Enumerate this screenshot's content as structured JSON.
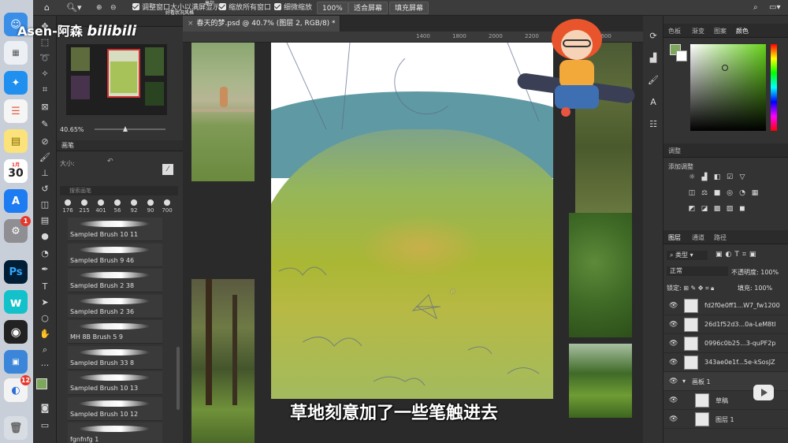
{
  "watermark": {
    "user": "Asen-阿森",
    "site": "bilibili"
  },
  "options_bar": {
    "resize_windows_label": "调整窗口大小以满屏显示",
    "zoom_all_label": "缩放所有窗口",
    "scrubby_zoom_label": "细微缩放",
    "zoom_percent": "100%",
    "fit_screen_label": "适合屏幕",
    "fill_screen_label": "填充屏幕",
    "tooltip_top": "高尔",
    "tooltip_bottom": "好看状况风格"
  },
  "document": {
    "tab_title": "春天的梦.psd @ 40.7% (图层 2, RGB/8) *",
    "ruler_marks": [
      "1400",
      "1800",
      "2000",
      "2200",
      "2400",
      "2600"
    ]
  },
  "navigator": {
    "zoom": "40.65%"
  },
  "brushes_panel": {
    "title": "画笔",
    "size_label": "大小:",
    "search_placeholder": "搜索画笔",
    "preset_sizes": [
      "176",
      "215",
      "401",
      "56",
      "92",
      "90",
      "700"
    ],
    "items": [
      {
        "label": "Sampled Brush 10 11"
      },
      {
        "label": "Sampled Brush 9 46"
      },
      {
        "label": "Sampled Brush 2 38"
      },
      {
        "label": "Sampled Brush 2 36"
      },
      {
        "label": "MH 8B Brush 5 9"
      },
      {
        "label": "Sampled Brush 33 8"
      },
      {
        "label": "Sampled Brush 10 13"
      },
      {
        "label": "Sampled Brush 10 12"
      },
      {
        "label": "fgnfnfg 1"
      }
    ]
  },
  "color_panel": {
    "tabs": [
      "色板",
      "渐变",
      "图案",
      "颜色"
    ],
    "active_tab": "颜色",
    "foreground": "#7da75a",
    "background": "#ffffff"
  },
  "adjustments_panel": {
    "title": "调整",
    "add_label": "添加调整"
  },
  "layers_panel": {
    "tabs": [
      "图层",
      "通道",
      "路径"
    ],
    "filter_kind": "类型",
    "blend_mode": "正常",
    "opacity_label": "不透明度:",
    "opacity": "100%",
    "lock_label": "锁定:",
    "fill_label": "填充:",
    "fill": "100%",
    "layers": [
      {
        "name": "fd2f0e0ff1...W7_fw1200"
      },
      {
        "name": "26d1f52d3...0a-LeM8tl"
      },
      {
        "name": "0996c0b25...3-quPF2p"
      },
      {
        "name": "343ae0e1f...5e-kSosJZ"
      },
      {
        "name": "画板 1"
      },
      {
        "name": "草稿"
      },
      {
        "name": "图层 1"
      }
    ]
  },
  "dock": {
    "calendar_month": "1月",
    "calendar_day": "30",
    "badge_a": "1",
    "badge_b": "12"
  },
  "subtitle": "草地刻意加了一些笔触进去",
  "colors": {
    "ps_blue": "#31a8ff",
    "accent": "#0a84ff"
  }
}
